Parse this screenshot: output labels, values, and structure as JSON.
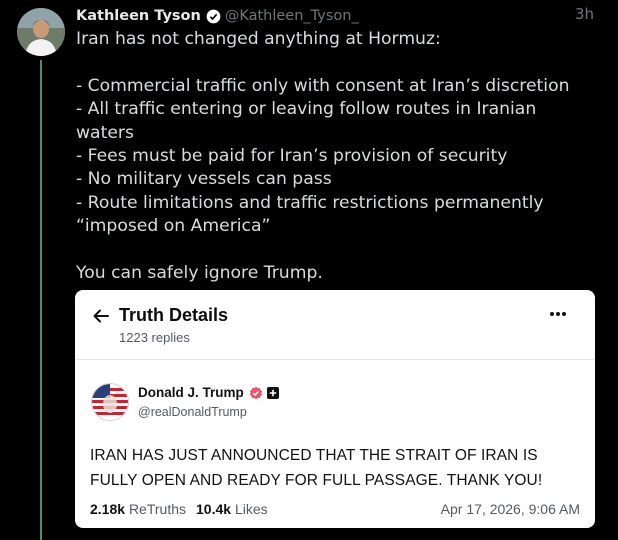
{
  "post": {
    "author_name": "Kathleen Tyson",
    "author_handle": "@Kathleen_Tyson_",
    "time": "3h",
    "verified": true,
    "lines": [
      "Iran has not changed anything at Hormuz:",
      "",
      "- Commercial traffic only with consent at Iran’s discretion",
      "- All traffic entering or leaving follow routes in Iranian",
      "waters",
      "- Fees must be paid for Iran’s provision of security",
      "- No military vessels can pass",
      "- Route limitations and traffic restrictions permanently",
      "“imposed on America”",
      "",
      "You can safely ignore Trump."
    ]
  },
  "embedded": {
    "title": "Truth Details",
    "replies": "1223 replies",
    "author_name": "Donald J. Trump",
    "author_handle": "@realDonaldTrump",
    "text_lines": [
      "IRAN HAS JUST ANNOUNCED THAT THE STRAIT OF IRAN IS",
      "FULLY OPEN AND READY FOR FULL PASSAGE. THANK YOU!"
    ],
    "retruths_count": "2.18k",
    "retruths_label": "ReTruths",
    "likes_count": "10.4k",
    "likes_label": "Likes",
    "date": "Apr 17, 2026, 9:06 AM"
  },
  "colors": {
    "background": "#000000",
    "thread_line": "#4a8f6f",
    "verified_badge": "#ffffff",
    "truth_badge": "#e9566c"
  },
  "icons": {
    "verified": "verified-badge-icon",
    "back": "arrow-left-icon",
    "more": "more-horizontal-icon",
    "truth_verified": "verified-badge-icon",
    "plus": "plus-icon"
  }
}
